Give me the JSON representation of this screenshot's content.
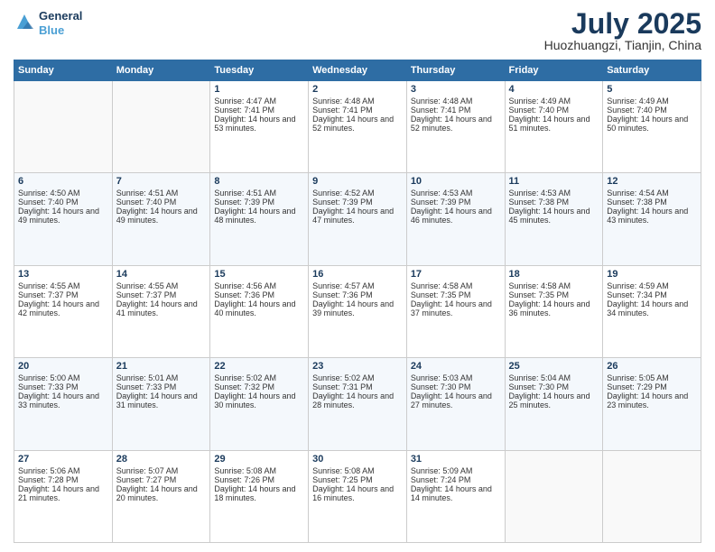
{
  "header": {
    "logo_line1": "General",
    "logo_line2": "Blue",
    "title": "July 2025",
    "location": "Huozhuangzi, Tianjin, China"
  },
  "weekdays": [
    "Sunday",
    "Monday",
    "Tuesday",
    "Wednesday",
    "Thursday",
    "Friday",
    "Saturday"
  ],
  "weeks": [
    [
      {
        "day": "",
        "sunrise": "",
        "sunset": "",
        "daylight": ""
      },
      {
        "day": "",
        "sunrise": "",
        "sunset": "",
        "daylight": ""
      },
      {
        "day": "1",
        "sunrise": "Sunrise: 4:47 AM",
        "sunset": "Sunset: 7:41 PM",
        "daylight": "Daylight: 14 hours and 53 minutes."
      },
      {
        "day": "2",
        "sunrise": "Sunrise: 4:48 AM",
        "sunset": "Sunset: 7:41 PM",
        "daylight": "Daylight: 14 hours and 52 minutes."
      },
      {
        "day": "3",
        "sunrise": "Sunrise: 4:48 AM",
        "sunset": "Sunset: 7:41 PM",
        "daylight": "Daylight: 14 hours and 52 minutes."
      },
      {
        "day": "4",
        "sunrise": "Sunrise: 4:49 AM",
        "sunset": "Sunset: 7:40 PM",
        "daylight": "Daylight: 14 hours and 51 minutes."
      },
      {
        "day": "5",
        "sunrise": "Sunrise: 4:49 AM",
        "sunset": "Sunset: 7:40 PM",
        "daylight": "Daylight: 14 hours and 50 minutes."
      }
    ],
    [
      {
        "day": "6",
        "sunrise": "Sunrise: 4:50 AM",
        "sunset": "Sunset: 7:40 PM",
        "daylight": "Daylight: 14 hours and 49 minutes."
      },
      {
        "day": "7",
        "sunrise": "Sunrise: 4:51 AM",
        "sunset": "Sunset: 7:40 PM",
        "daylight": "Daylight: 14 hours and 49 minutes."
      },
      {
        "day": "8",
        "sunrise": "Sunrise: 4:51 AM",
        "sunset": "Sunset: 7:39 PM",
        "daylight": "Daylight: 14 hours and 48 minutes."
      },
      {
        "day": "9",
        "sunrise": "Sunrise: 4:52 AM",
        "sunset": "Sunset: 7:39 PM",
        "daylight": "Daylight: 14 hours and 47 minutes."
      },
      {
        "day": "10",
        "sunrise": "Sunrise: 4:53 AM",
        "sunset": "Sunset: 7:39 PM",
        "daylight": "Daylight: 14 hours and 46 minutes."
      },
      {
        "day": "11",
        "sunrise": "Sunrise: 4:53 AM",
        "sunset": "Sunset: 7:38 PM",
        "daylight": "Daylight: 14 hours and 45 minutes."
      },
      {
        "day": "12",
        "sunrise": "Sunrise: 4:54 AM",
        "sunset": "Sunset: 7:38 PM",
        "daylight": "Daylight: 14 hours and 43 minutes."
      }
    ],
    [
      {
        "day": "13",
        "sunrise": "Sunrise: 4:55 AM",
        "sunset": "Sunset: 7:37 PM",
        "daylight": "Daylight: 14 hours and 42 minutes."
      },
      {
        "day": "14",
        "sunrise": "Sunrise: 4:55 AM",
        "sunset": "Sunset: 7:37 PM",
        "daylight": "Daylight: 14 hours and 41 minutes."
      },
      {
        "day": "15",
        "sunrise": "Sunrise: 4:56 AM",
        "sunset": "Sunset: 7:36 PM",
        "daylight": "Daylight: 14 hours and 40 minutes."
      },
      {
        "day": "16",
        "sunrise": "Sunrise: 4:57 AM",
        "sunset": "Sunset: 7:36 PM",
        "daylight": "Daylight: 14 hours and 39 minutes."
      },
      {
        "day": "17",
        "sunrise": "Sunrise: 4:58 AM",
        "sunset": "Sunset: 7:35 PM",
        "daylight": "Daylight: 14 hours and 37 minutes."
      },
      {
        "day": "18",
        "sunrise": "Sunrise: 4:58 AM",
        "sunset": "Sunset: 7:35 PM",
        "daylight": "Daylight: 14 hours and 36 minutes."
      },
      {
        "day": "19",
        "sunrise": "Sunrise: 4:59 AM",
        "sunset": "Sunset: 7:34 PM",
        "daylight": "Daylight: 14 hours and 34 minutes."
      }
    ],
    [
      {
        "day": "20",
        "sunrise": "Sunrise: 5:00 AM",
        "sunset": "Sunset: 7:33 PM",
        "daylight": "Daylight: 14 hours and 33 minutes."
      },
      {
        "day": "21",
        "sunrise": "Sunrise: 5:01 AM",
        "sunset": "Sunset: 7:33 PM",
        "daylight": "Daylight: 14 hours and 31 minutes."
      },
      {
        "day": "22",
        "sunrise": "Sunrise: 5:02 AM",
        "sunset": "Sunset: 7:32 PM",
        "daylight": "Daylight: 14 hours and 30 minutes."
      },
      {
        "day": "23",
        "sunrise": "Sunrise: 5:02 AM",
        "sunset": "Sunset: 7:31 PM",
        "daylight": "Daylight: 14 hours and 28 minutes."
      },
      {
        "day": "24",
        "sunrise": "Sunrise: 5:03 AM",
        "sunset": "Sunset: 7:30 PM",
        "daylight": "Daylight: 14 hours and 27 minutes."
      },
      {
        "day": "25",
        "sunrise": "Sunrise: 5:04 AM",
        "sunset": "Sunset: 7:30 PM",
        "daylight": "Daylight: 14 hours and 25 minutes."
      },
      {
        "day": "26",
        "sunrise": "Sunrise: 5:05 AM",
        "sunset": "Sunset: 7:29 PM",
        "daylight": "Daylight: 14 hours and 23 minutes."
      }
    ],
    [
      {
        "day": "27",
        "sunrise": "Sunrise: 5:06 AM",
        "sunset": "Sunset: 7:28 PM",
        "daylight": "Daylight: 14 hours and 21 minutes."
      },
      {
        "day": "28",
        "sunrise": "Sunrise: 5:07 AM",
        "sunset": "Sunset: 7:27 PM",
        "daylight": "Daylight: 14 hours and 20 minutes."
      },
      {
        "day": "29",
        "sunrise": "Sunrise: 5:08 AM",
        "sunset": "Sunset: 7:26 PM",
        "daylight": "Daylight: 14 hours and 18 minutes."
      },
      {
        "day": "30",
        "sunrise": "Sunrise: 5:08 AM",
        "sunset": "Sunset: 7:25 PM",
        "daylight": "Daylight: 14 hours and 16 minutes."
      },
      {
        "day": "31",
        "sunrise": "Sunrise: 5:09 AM",
        "sunset": "Sunset: 7:24 PM",
        "daylight": "Daylight: 14 hours and 14 minutes."
      },
      {
        "day": "",
        "sunrise": "",
        "sunset": "",
        "daylight": ""
      },
      {
        "day": "",
        "sunrise": "",
        "sunset": "",
        "daylight": ""
      }
    ]
  ]
}
